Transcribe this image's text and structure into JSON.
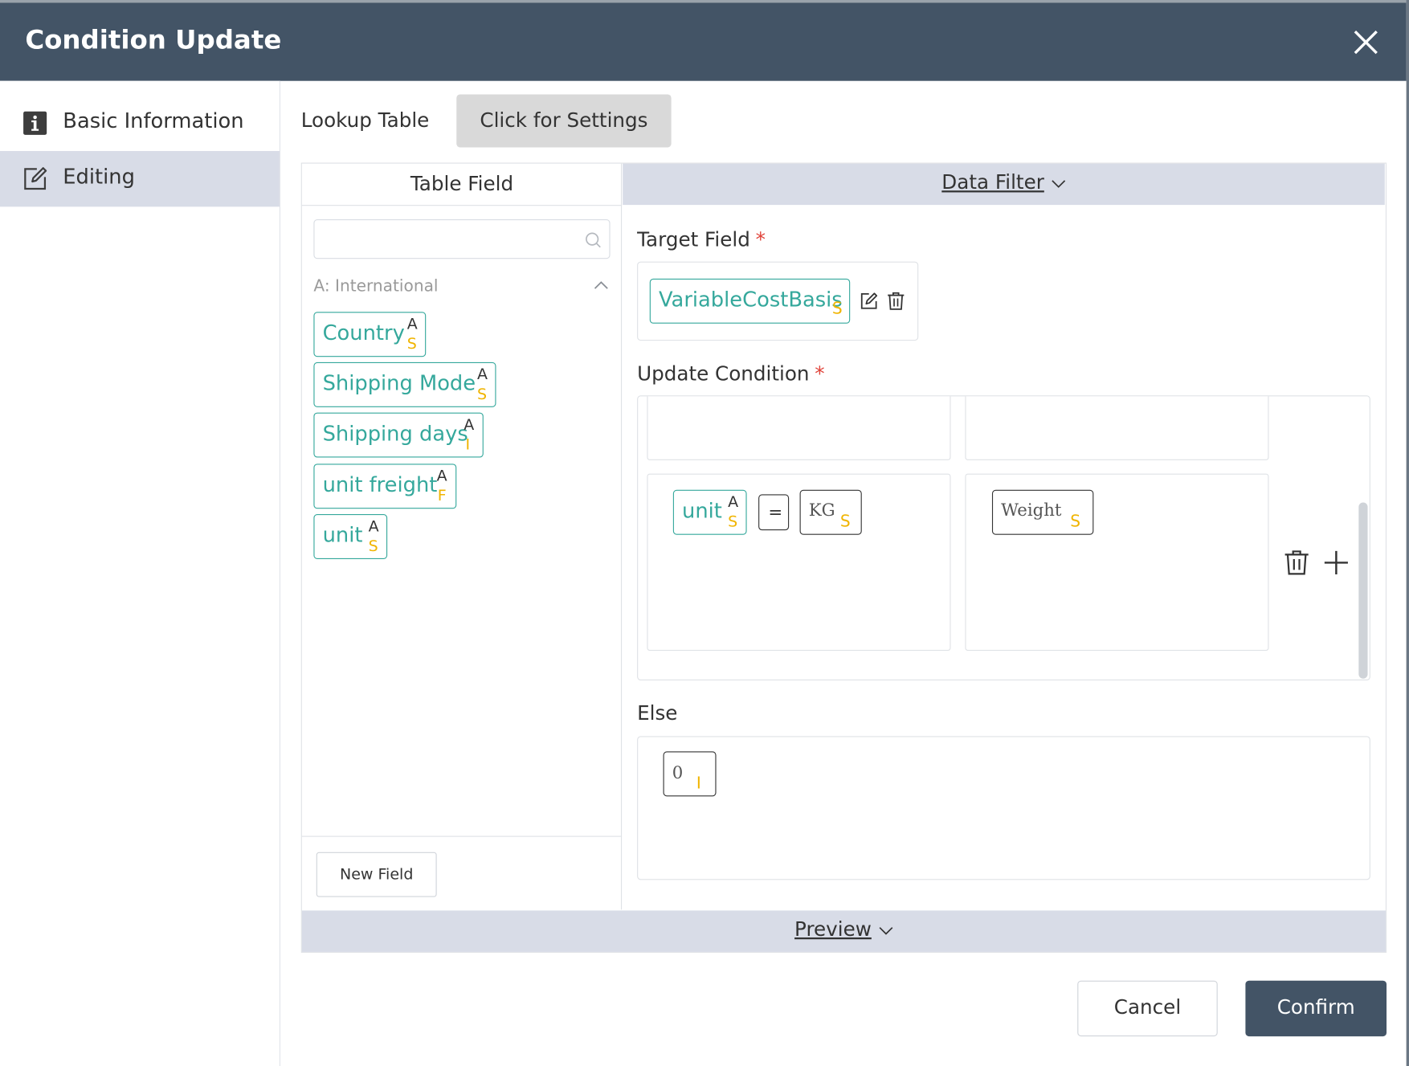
{
  "dialog": {
    "title": "Condition Update"
  },
  "sidebar": {
    "items": [
      {
        "label": "Basic Information",
        "icon": "info-icon",
        "active": false
      },
      {
        "label": "Editing",
        "icon": "edit-icon",
        "active": true
      }
    ]
  },
  "lookup": {
    "label": "Lookup Table",
    "settings_button": "Click for Settings"
  },
  "table_field": {
    "header": "Table Field",
    "search_placeholder": "",
    "group_label": "A: International",
    "fields": [
      {
        "name": "Country",
        "source": "A",
        "type": "S"
      },
      {
        "name": "Shipping Mode",
        "source": "A",
        "type": "S"
      },
      {
        "name": "Shipping days",
        "source": "A",
        "type": "I"
      },
      {
        "name": "unit freight",
        "source": "A",
        "type": "F"
      },
      {
        "name": "unit",
        "source": "A",
        "type": "S"
      }
    ],
    "new_field_button": "New Field"
  },
  "data_filter": {
    "header": "Data Filter",
    "target_field": {
      "label": "Target Field",
      "required_mark": "*",
      "value": "VariableCostBasis",
      "type": "S"
    },
    "update_condition": {
      "label": "Update Condition",
      "required_mark": "*",
      "condition": {
        "field": "unit",
        "field_source": "A",
        "field_type": "S",
        "operator": "=",
        "value": "KG",
        "value_type": "S"
      },
      "result": {
        "value": "Weight",
        "type": "S"
      }
    },
    "else": {
      "label": "Else",
      "value": "0",
      "type": "I"
    }
  },
  "preview": {
    "label": "Preview"
  },
  "footer": {
    "cancel": "Cancel",
    "confirm": "Confirm"
  },
  "colors": {
    "header_bg": "#435466",
    "accent_teal": "#35a89c",
    "type_yellow": "#f0b400",
    "active_bg": "#d8dce7",
    "required_red": "#e0433a"
  }
}
